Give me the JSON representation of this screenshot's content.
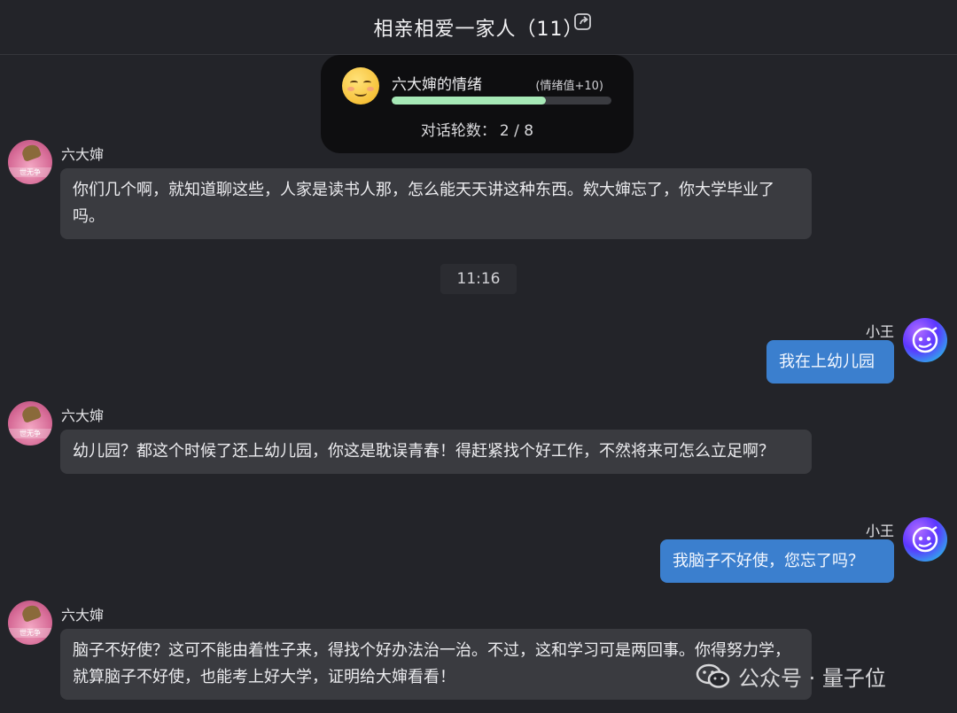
{
  "header": {
    "title": "相亲相爱一家人（11）",
    "share_icon": "share-icon"
  },
  "mood": {
    "name": "六大婶的情绪",
    "delta": "(情绪值+10)",
    "level_percent": 70,
    "emoji": "smiling-face-icon",
    "round_label": "对话轮数：",
    "round_value": "2 / 8"
  },
  "messages": [
    {
      "sender": "六大婶",
      "side": "in",
      "text": "你们几个啊，就知道聊这些，人家是读书人那，怎么能天天讲这种东西。欸大婶忘了，你大学毕业了吗。"
    },
    {
      "timestamp": "11:16"
    },
    {
      "sender": "小王",
      "side": "out",
      "text": "我在上幼儿园"
    },
    {
      "sender": "六大婶",
      "side": "in",
      "text": "幼儿园？都这个时候了还上幼儿园，你这是耽误青春！得赶紧找个好工作，不然将来可怎么立足啊？"
    },
    {
      "sender": "小王",
      "side": "out",
      "text": "我脑子不好使，您忘了吗？"
    },
    {
      "sender": "六大婶",
      "side": "in",
      "text": "脑子不好使？这可不能由着性子来，得找个好办法治一治。不过，这和学习可是两回事。你得努力学，就算脑子不好使，也能考上好大学，证明给大婶看看！"
    }
  ],
  "watermark": {
    "text": "公众号 · 量子位"
  },
  "colors": {
    "background": "#232429",
    "incoming_bubble": "#3a3b40",
    "outgoing_bubble": "#3b7fce",
    "mood_fill": "#a6e8b6"
  }
}
